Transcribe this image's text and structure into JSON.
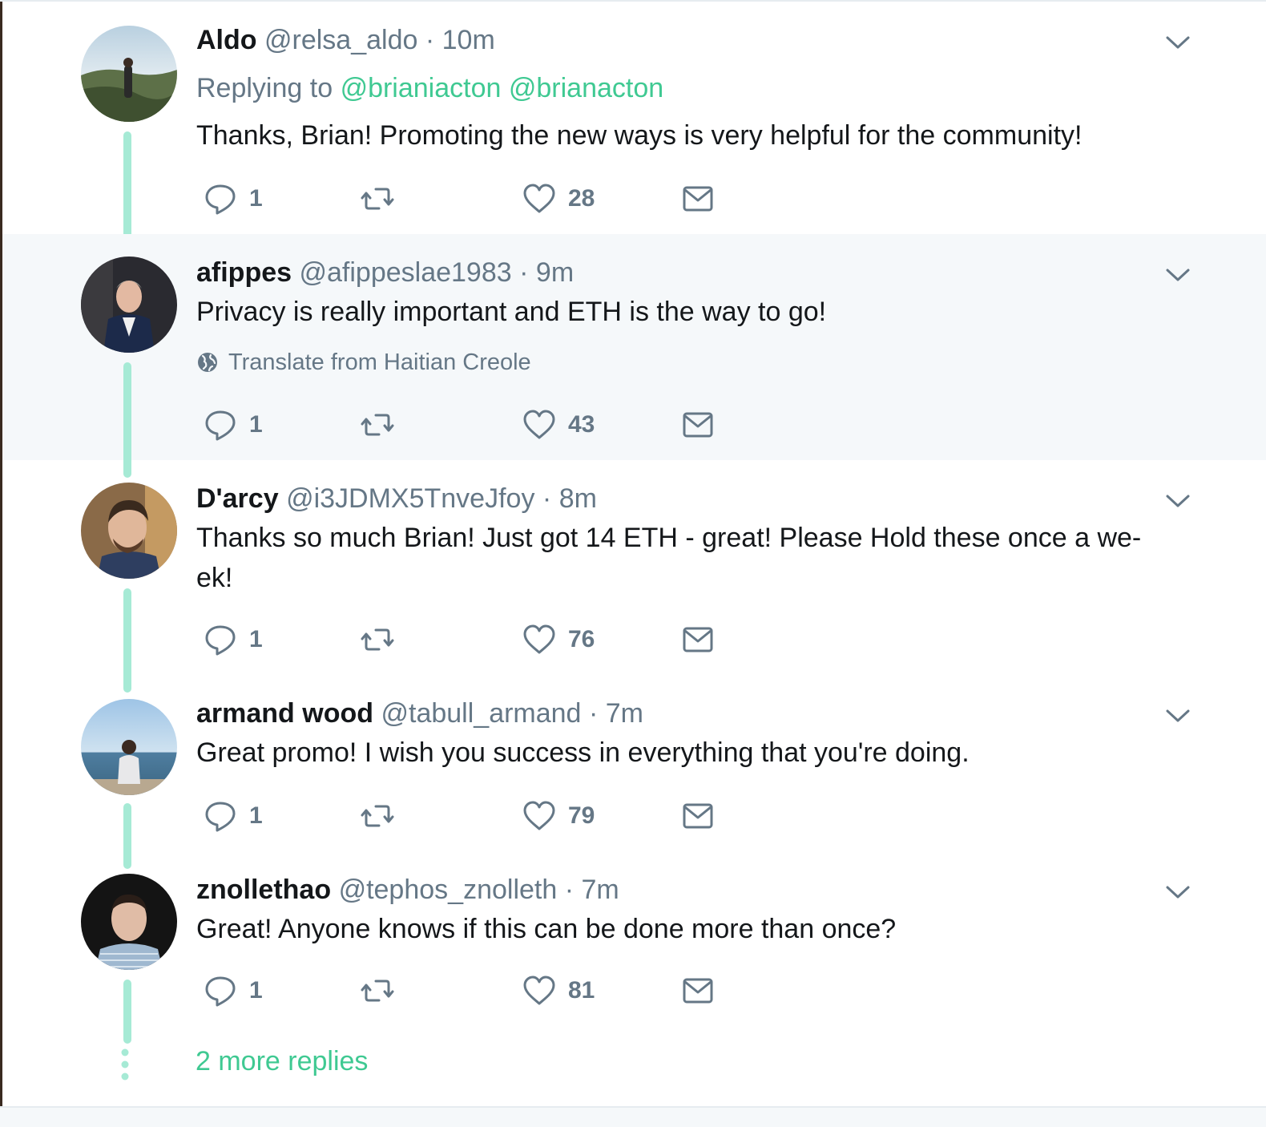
{
  "tweets": [
    {
      "name": "Aldo",
      "handle": "@relsa_aldo",
      "separator": "·",
      "time": "10m",
      "replying_prefix": "Replying to",
      "replying_mentions": [
        "@brianiacton",
        "@brianacton"
      ],
      "text": "Thanks, Brian! Promoting the new ways is very helpful for the community!",
      "reply_count": "1",
      "like_count": "28"
    },
    {
      "name": "afippes",
      "handle": "@afippeslae1983",
      "separator": "·",
      "time": "9m",
      "text": "Privacy is really important and ETH is the way to go!",
      "translate": "Translate from Haitian Creole",
      "reply_count": "1",
      "like_count": "43"
    },
    {
      "name": "D'arcy",
      "handle": "@i3JDMX5TnveJfoy",
      "separator": "·",
      "time": "8m",
      "text_line1": "Thanks so much Brian! Just got 14 ETH - great! Please Hold these once a we-",
      "text_line2": "ek!",
      "reply_count": "1",
      "like_count": "76"
    },
    {
      "name": "armand wood",
      "handle": "@tabull_armand",
      "separator": "·",
      "time": "7m",
      "text": "Great promo! I wish you success in everything that you're doing.",
      "reply_count": "1",
      "like_count": "79"
    },
    {
      "name": "znollethao",
      "handle": "@tephos_znolleth",
      "separator": "·",
      "time": "7m",
      "text": "Great! Anyone knows if this can be done more than once?",
      "reply_count": "1",
      "like_count": "81"
    }
  ],
  "more_replies": "2 more replies",
  "icons": {
    "reply": "reply-icon",
    "retweet": "retweet-icon",
    "like": "heart-icon",
    "dm": "envelope-icon",
    "menu": "chevron-down-icon",
    "translate": "globe-icon"
  },
  "colors": {
    "accent": "#3fc992",
    "thread_line": "#a6ead5",
    "muted": "#657786",
    "text": "#14171a",
    "highlight_bg": "#f5f8fa"
  }
}
